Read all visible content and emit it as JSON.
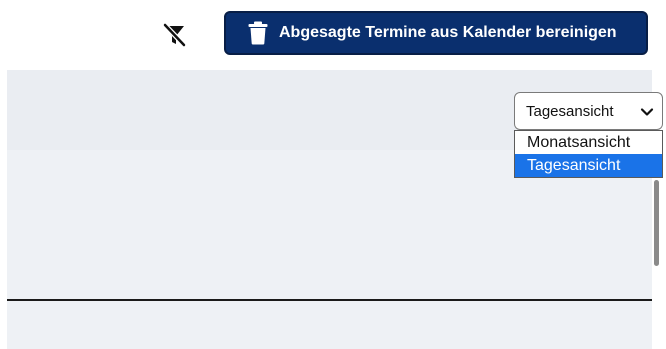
{
  "toolbar": {
    "filter_icon": "filter-off-icon",
    "clear_cancelled_button": {
      "icon": "trash-icon",
      "label": "Abgesagte Termine aus Kalender bereinigen"
    }
  },
  "view_select": {
    "value": "Tagesansicht",
    "options": [
      "Monatsansicht",
      "Tagesansicht"
    ],
    "selected_index": 1
  },
  "colors": {
    "button_bg": "#0a2f6e",
    "selected_option": "#1a73e8",
    "content_bg": "#eef1f5"
  }
}
